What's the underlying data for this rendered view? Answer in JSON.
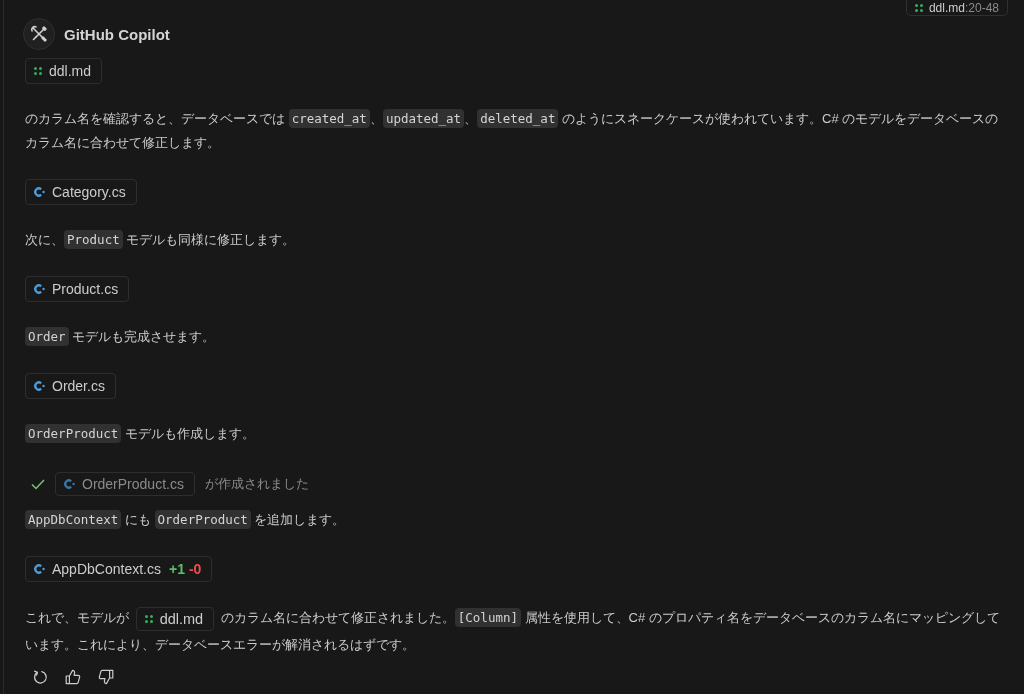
{
  "reference": {
    "chip": {
      "kind": "markdown",
      "name": "ddl.md"
    },
    "range": ":20-48"
  },
  "author": {
    "name": "GitHub Copilot"
  },
  "blocks": [
    {
      "kind": "file",
      "chip": {
        "kind": "markdown",
        "name": "ddl.md"
      }
    },
    {
      "kind": "paragraph",
      "parts": [
        {
          "kind": "text",
          "text": "のカラム名を確認すると、データベースでは "
        },
        {
          "kind": "code",
          "text": "created_at"
        },
        {
          "kind": "text",
          "text": "、"
        },
        {
          "kind": "code",
          "text": "updated_at"
        },
        {
          "kind": "text",
          "text": "、"
        },
        {
          "kind": "code",
          "text": "deleted_at"
        },
        {
          "kind": "text",
          "text": " のようにスネークケースが使われています。C# のモデルをデータベースのカラム名に合わせて修正します。"
        }
      ]
    },
    {
      "kind": "file",
      "chip": {
        "kind": "csharp",
        "name": "Category.cs"
      }
    },
    {
      "kind": "paragraph",
      "parts": [
        {
          "kind": "text",
          "text": "次に、"
        },
        {
          "kind": "code",
          "text": "Product"
        },
        {
          "kind": "text",
          "text": " モデルも同様に修正します。"
        }
      ]
    },
    {
      "kind": "file",
      "chip": {
        "kind": "csharp",
        "name": "Product.cs"
      }
    },
    {
      "kind": "paragraph",
      "parts": [
        {
          "kind": "code",
          "text": "Order"
        },
        {
          "kind": "text",
          "text": " モデルも完成させます。"
        }
      ]
    },
    {
      "kind": "file",
      "chip": {
        "kind": "csharp",
        "name": "Order.cs"
      }
    },
    {
      "kind": "paragraph",
      "parts": [
        {
          "kind": "code",
          "text": "OrderProduct"
        },
        {
          "kind": "text",
          "text": " モデルも作成します。"
        }
      ]
    },
    {
      "kind": "notice",
      "done": true,
      "chip": {
        "kind": "csharp",
        "name": "OrderProduct.cs"
      },
      "text": "が作成されました"
    },
    {
      "kind": "paragraph",
      "parts": [
        {
          "kind": "code",
          "text": "AppDbContext"
        },
        {
          "kind": "text",
          "text": " にも "
        },
        {
          "kind": "code",
          "text": "OrderProduct"
        },
        {
          "kind": "text",
          "text": " を追加します。"
        }
      ]
    },
    {
      "kind": "file",
      "chip": {
        "kind": "csharp",
        "name": "AppDbContext.cs"
      },
      "added": "+1",
      "removed": "-0"
    },
    {
      "kind": "paragraph",
      "parts": [
        {
          "kind": "text",
          "text": "これで、モデルが "
        },
        {
          "kind": "file",
          "chip": {
            "kind": "markdown",
            "name": "ddl.md"
          }
        },
        {
          "kind": "text",
          "text": " のカラム名に合わせて修正されました。"
        },
        {
          "kind": "code",
          "text": "[Column]"
        },
        {
          "kind": "text",
          "text": " 属性を使用して、C# のプロパティ名をデータベースのカラム名にマッピングしています。これにより、データベースエラーが解消されるはずです。"
        }
      ]
    }
  ]
}
